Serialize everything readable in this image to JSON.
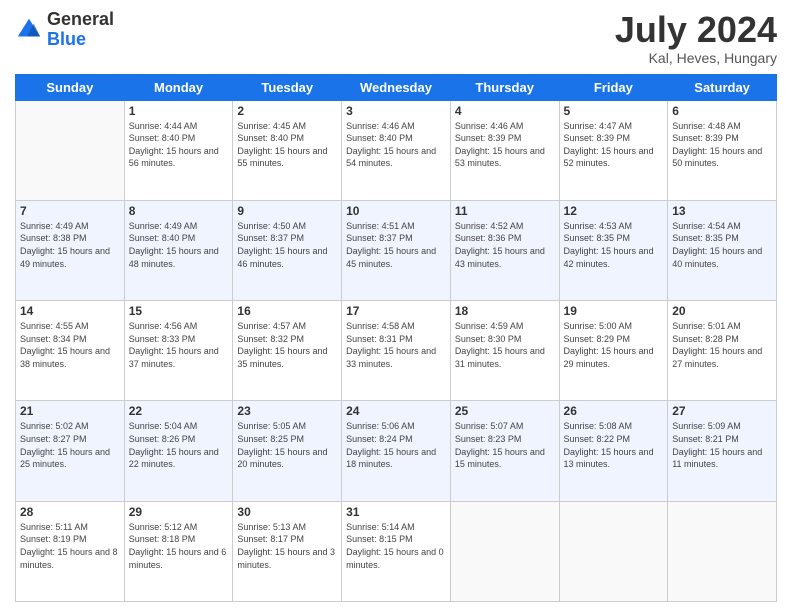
{
  "logo": {
    "general": "General",
    "blue": "Blue"
  },
  "header": {
    "title": "July 2024",
    "subtitle": "Kal, Heves, Hungary"
  },
  "weekdays": [
    "Sunday",
    "Monday",
    "Tuesday",
    "Wednesday",
    "Thursday",
    "Friday",
    "Saturday"
  ],
  "weeks": [
    [
      {
        "day": null
      },
      {
        "day": "1",
        "sunrise": "Sunrise: 4:44 AM",
        "sunset": "Sunset: 8:40 PM",
        "daylight": "Daylight: 15 hours and 56 minutes."
      },
      {
        "day": "2",
        "sunrise": "Sunrise: 4:45 AM",
        "sunset": "Sunset: 8:40 PM",
        "daylight": "Daylight: 15 hours and 55 minutes."
      },
      {
        "day": "3",
        "sunrise": "Sunrise: 4:46 AM",
        "sunset": "Sunset: 8:40 PM",
        "daylight": "Daylight: 15 hours and 54 minutes."
      },
      {
        "day": "4",
        "sunrise": "Sunrise: 4:46 AM",
        "sunset": "Sunset: 8:39 PM",
        "daylight": "Daylight: 15 hours and 53 minutes."
      },
      {
        "day": "5",
        "sunrise": "Sunrise: 4:47 AM",
        "sunset": "Sunset: 8:39 PM",
        "daylight": "Daylight: 15 hours and 52 minutes."
      },
      {
        "day": "6",
        "sunrise": "Sunrise: 4:48 AM",
        "sunset": "Sunset: 8:39 PM",
        "daylight": "Daylight: 15 hours and 50 minutes."
      }
    ],
    [
      {
        "day": "7",
        "sunrise": "Sunrise: 4:49 AM",
        "sunset": "Sunset: 8:38 PM",
        "daylight": "Daylight: 15 hours and 49 minutes."
      },
      {
        "day": "8",
        "sunrise": "Sunrise: 4:49 AM",
        "sunset": "Sunset: 8:40 PM",
        "daylight": "Daylight: 15 hours and 48 minutes."
      },
      {
        "day": "9",
        "sunrise": "Sunrise: 4:50 AM",
        "sunset": "Sunset: 8:37 PM",
        "daylight": "Daylight: 15 hours and 46 minutes."
      },
      {
        "day": "10",
        "sunrise": "Sunrise: 4:51 AM",
        "sunset": "Sunset: 8:37 PM",
        "daylight": "Daylight: 15 hours and 45 minutes."
      },
      {
        "day": "11",
        "sunrise": "Sunrise: 4:52 AM",
        "sunset": "Sunset: 8:36 PM",
        "daylight": "Daylight: 15 hours and 43 minutes."
      },
      {
        "day": "12",
        "sunrise": "Sunrise: 4:53 AM",
        "sunset": "Sunset: 8:35 PM",
        "daylight": "Daylight: 15 hours and 42 minutes."
      },
      {
        "day": "13",
        "sunrise": "Sunrise: 4:54 AM",
        "sunset": "Sunset: 8:35 PM",
        "daylight": "Daylight: 15 hours and 40 minutes."
      }
    ],
    [
      {
        "day": "14",
        "sunrise": "Sunrise: 4:55 AM",
        "sunset": "Sunset: 8:34 PM",
        "daylight": "Daylight: 15 hours and 38 minutes."
      },
      {
        "day": "15",
        "sunrise": "Sunrise: 4:56 AM",
        "sunset": "Sunset: 8:33 PM",
        "daylight": "Daylight: 15 hours and 37 minutes."
      },
      {
        "day": "16",
        "sunrise": "Sunrise: 4:57 AM",
        "sunset": "Sunset: 8:32 PM",
        "daylight": "Daylight: 15 hours and 35 minutes."
      },
      {
        "day": "17",
        "sunrise": "Sunrise: 4:58 AM",
        "sunset": "Sunset: 8:31 PM",
        "daylight": "Daylight: 15 hours and 33 minutes."
      },
      {
        "day": "18",
        "sunrise": "Sunrise: 4:59 AM",
        "sunset": "Sunset: 8:30 PM",
        "daylight": "Daylight: 15 hours and 31 minutes."
      },
      {
        "day": "19",
        "sunrise": "Sunrise: 5:00 AM",
        "sunset": "Sunset: 8:29 PM",
        "daylight": "Daylight: 15 hours and 29 minutes."
      },
      {
        "day": "20",
        "sunrise": "Sunrise: 5:01 AM",
        "sunset": "Sunset: 8:28 PM",
        "daylight": "Daylight: 15 hours and 27 minutes."
      }
    ],
    [
      {
        "day": "21",
        "sunrise": "Sunrise: 5:02 AM",
        "sunset": "Sunset: 8:27 PM",
        "daylight": "Daylight: 15 hours and 25 minutes."
      },
      {
        "day": "22",
        "sunrise": "Sunrise: 5:04 AM",
        "sunset": "Sunset: 8:26 PM",
        "daylight": "Daylight: 15 hours and 22 minutes."
      },
      {
        "day": "23",
        "sunrise": "Sunrise: 5:05 AM",
        "sunset": "Sunset: 8:25 PM",
        "daylight": "Daylight: 15 hours and 20 minutes."
      },
      {
        "day": "24",
        "sunrise": "Sunrise: 5:06 AM",
        "sunset": "Sunset: 8:24 PM",
        "daylight": "Daylight: 15 hours and 18 minutes."
      },
      {
        "day": "25",
        "sunrise": "Sunrise: 5:07 AM",
        "sunset": "Sunset: 8:23 PM",
        "daylight": "Daylight: 15 hours and 15 minutes."
      },
      {
        "day": "26",
        "sunrise": "Sunrise: 5:08 AM",
        "sunset": "Sunset: 8:22 PM",
        "daylight": "Daylight: 15 hours and 13 minutes."
      },
      {
        "day": "27",
        "sunrise": "Sunrise: 5:09 AM",
        "sunset": "Sunset: 8:21 PM",
        "daylight": "Daylight: 15 hours and 11 minutes."
      }
    ],
    [
      {
        "day": "28",
        "sunrise": "Sunrise: 5:11 AM",
        "sunset": "Sunset: 8:19 PM",
        "daylight": "Daylight: 15 hours and 8 minutes."
      },
      {
        "day": "29",
        "sunrise": "Sunrise: 5:12 AM",
        "sunset": "Sunset: 8:18 PM",
        "daylight": "Daylight: 15 hours and 6 minutes."
      },
      {
        "day": "30",
        "sunrise": "Sunrise: 5:13 AM",
        "sunset": "Sunset: 8:17 PM",
        "daylight": "Daylight: 15 hours and 3 minutes."
      },
      {
        "day": "31",
        "sunrise": "Sunrise: 5:14 AM",
        "sunset": "Sunset: 8:15 PM",
        "daylight": "Daylight: 15 hours and 0 minutes."
      },
      {
        "day": null
      },
      {
        "day": null
      },
      {
        "day": null
      }
    ]
  ]
}
